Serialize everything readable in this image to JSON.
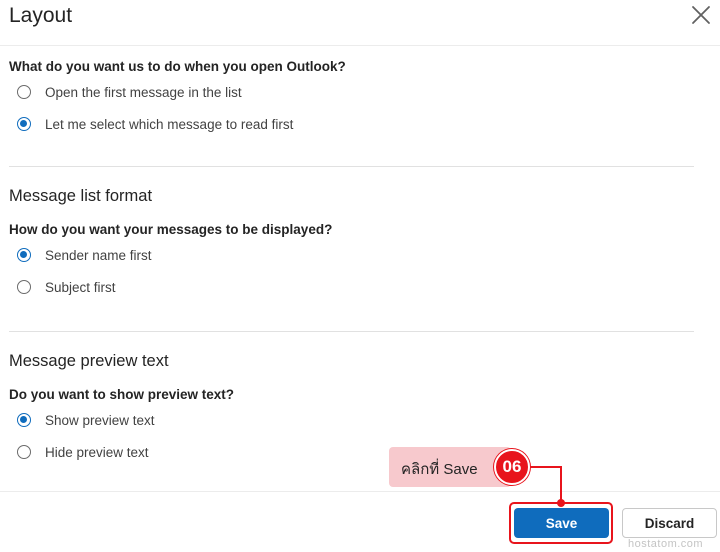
{
  "dialog": {
    "title": "Layout"
  },
  "open_outlook": {
    "question": "What do you want us to do when you open Outlook?",
    "options": [
      {
        "label": "Open the first message in the list",
        "selected": false
      },
      {
        "label": "Let me select which message to read first",
        "selected": true
      }
    ]
  },
  "message_list": {
    "heading": "Message list format",
    "question": "How do you want your messages to be displayed?",
    "options": [
      {
        "label": "Sender name first",
        "selected": true
      },
      {
        "label": "Subject first",
        "selected": false
      }
    ]
  },
  "preview": {
    "heading": "Message preview text",
    "question": "Do you want to show preview text?",
    "options": [
      {
        "label": "Show preview text",
        "selected": true
      },
      {
        "label": "Hide preview text",
        "selected": false
      }
    ]
  },
  "footer": {
    "save_label": "Save",
    "discard_label": "Discard"
  },
  "annotation": {
    "callout_text": "คลิกที่ Save",
    "step_number": "06"
  },
  "watermark": "hostatom.com",
  "colors": {
    "accent": "#0f6cbd",
    "annotation_red": "#e8141c",
    "callout_pink": "#f7c9cd"
  }
}
